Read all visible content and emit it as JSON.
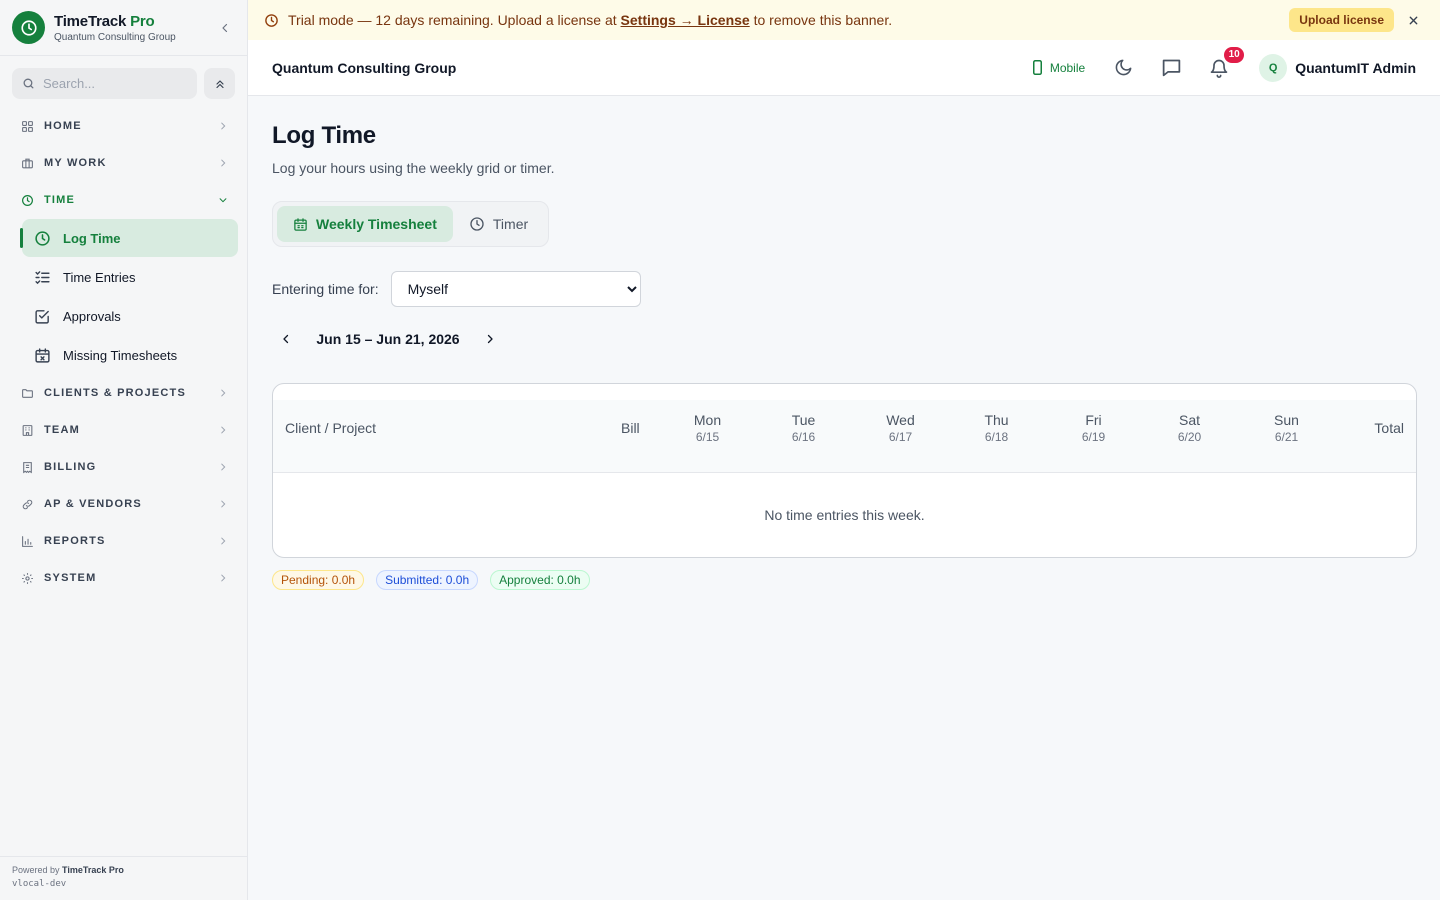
{
  "brand": {
    "name": "TimeTrack",
    "name_suffix": "Pro",
    "org": "Quantum Consulting Group"
  },
  "search": {
    "placeholder": "Search..."
  },
  "nav": {
    "home": "HOME",
    "my_work": "MY WORK",
    "time": "TIME",
    "time_items": [
      "Log Time",
      "Time Entries",
      "Approvals",
      "Missing Timesheets"
    ],
    "clients_projects": "CLIENTS & PROJECTS",
    "team": "TEAM",
    "billing": "BILLING",
    "ap_vendors": "AP & VENDORS",
    "reports": "REPORTS",
    "system": "SYSTEM"
  },
  "footer": {
    "powered_by": "Powered by",
    "powered_name": "TimeTrack Pro",
    "version": "vlocal-dev"
  },
  "banner": {
    "text_before": "Trial mode — 12 days remaining. Upload a license at",
    "link": "Settings → License",
    "text_after": "to remove this banner.",
    "button": "Upload license"
  },
  "header": {
    "org_name": "Quantum Consulting Group",
    "mobile": "Mobile",
    "notifications_count": "10",
    "user_initial": "Q",
    "user_name": "QuantumIT Admin"
  },
  "page": {
    "title": "Log Time",
    "subtitle": "Log your hours using the weekly grid or timer.",
    "tabs": [
      "Weekly Timesheet",
      "Timer"
    ],
    "entering_for_label": "Entering time for:",
    "entering_for_value": "Myself",
    "week_range": "Jun 15 – Jun 21, 2026"
  },
  "table": {
    "col_client": "Client / Project",
    "col_bill": "Bill",
    "days": [
      {
        "day": "Mon",
        "date": "6/15"
      },
      {
        "day": "Tue",
        "date": "6/16"
      },
      {
        "day": "Wed",
        "date": "6/17"
      },
      {
        "day": "Thu",
        "date": "6/18"
      },
      {
        "day": "Fri",
        "date": "6/19"
      },
      {
        "day": "Sat",
        "date": "6/20"
      },
      {
        "day": "Sun",
        "date": "6/21"
      }
    ],
    "col_total": "Total",
    "empty": "No time entries this week."
  },
  "status": {
    "pending": "Pending: 0.0h",
    "submitted": "Submitted: 0.0h",
    "approved": "Approved: 0.0h"
  },
  "colors": {
    "accent": "#15803d",
    "banner_bg": "#fefbe8",
    "badge": "#e11d48"
  }
}
